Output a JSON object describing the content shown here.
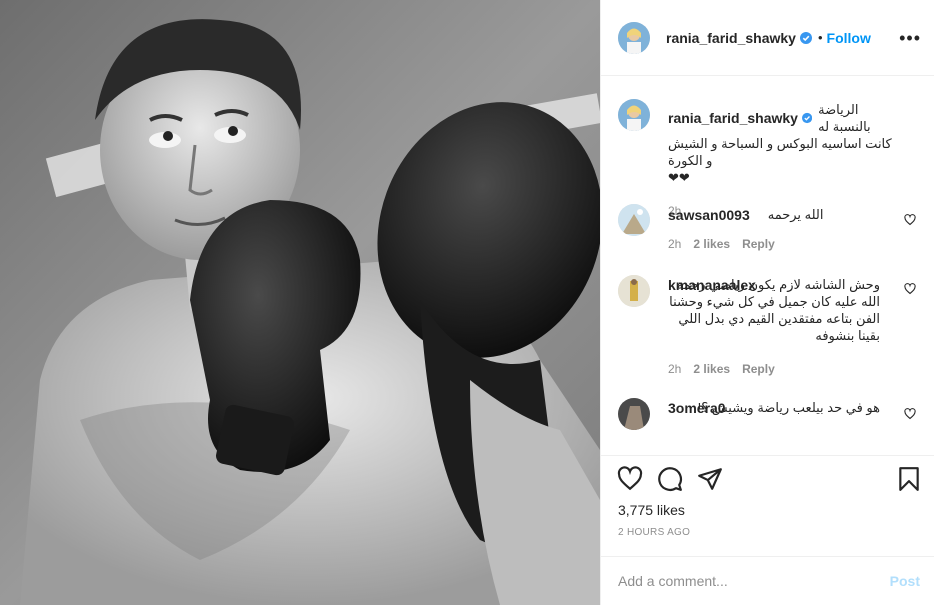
{
  "post": {
    "author": "rania_farid_shawky",
    "follow_label": "Follow",
    "separator": "•",
    "more_label": "•••"
  },
  "caption": {
    "user": "rania_farid_shawky",
    "line1": "الرياضة بالنسبة له",
    "line2": "كانت اساسيه البوكس و السباحة و الشيش و الكورة",
    "hearts": "❤❤",
    "time": "2h"
  },
  "comments": [
    {
      "user": "sawsan0093",
      "text": "الله يرحمه",
      "time": "2h",
      "likes": "2 likes",
      "reply": "Reply"
    },
    {
      "user": "kmananaalex",
      "text": "وحش الشاشه لازم يكون رياضي رحمة الله عليه كان جميل في كل شيء وحشنا الفن بتاعه مفتقدين القيم دي بدل اللي بقينا بنشوفه",
      "time": "2h",
      "likes": "2 likes",
      "reply": "Reply"
    },
    {
      "user": "3omera0",
      "text": "هو في حد بيلعب رياضة ويشيش ؟!",
      "time": "",
      "likes": "",
      "reply": ""
    }
  ],
  "actions": {
    "likes": "3,775 likes",
    "time_ago": "2 HOURS AGO",
    "comment_placeholder": "Add a comment...",
    "post_label": "Post"
  },
  "colors": {
    "accent": "#0095f6",
    "post_disabled": "#b2dffc",
    "muted": "#8e8e8e",
    "text": "#262626"
  },
  "icons": [
    "verified-badge-icon",
    "more-options-icon",
    "heart-icon",
    "comment-icon",
    "share-icon",
    "bookmark-icon"
  ]
}
